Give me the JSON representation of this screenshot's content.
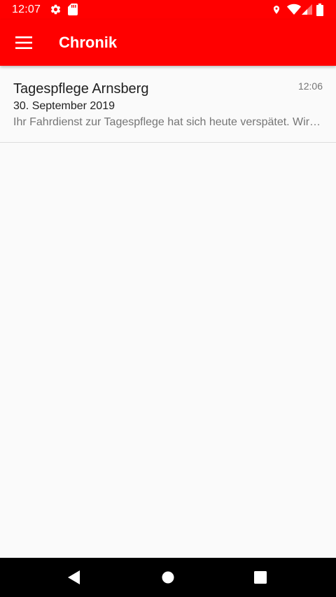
{
  "status_bar": {
    "time": "12:07",
    "icons": [
      "gear-icon",
      "sd-card-icon",
      "location-icon",
      "wifi-icon",
      "signal-icon",
      "battery-icon"
    ]
  },
  "app_bar": {
    "title": "Chronik",
    "menu_icon": "hamburger-menu-icon",
    "background": "#ff0000",
    "text_color": "#ffffff"
  },
  "timeline": {
    "items": [
      {
        "title": "Tagespflege Arnsberg",
        "time": "12:06",
        "date": "30. September 2019",
        "preview": "Ihr Fahrdienst zur Tagespflege hat sich heute verspätet. Wir bitten um Entschuldigung."
      }
    ]
  },
  "nav_bar": {
    "buttons": [
      "back-icon",
      "home-icon",
      "recents-icon"
    ]
  }
}
